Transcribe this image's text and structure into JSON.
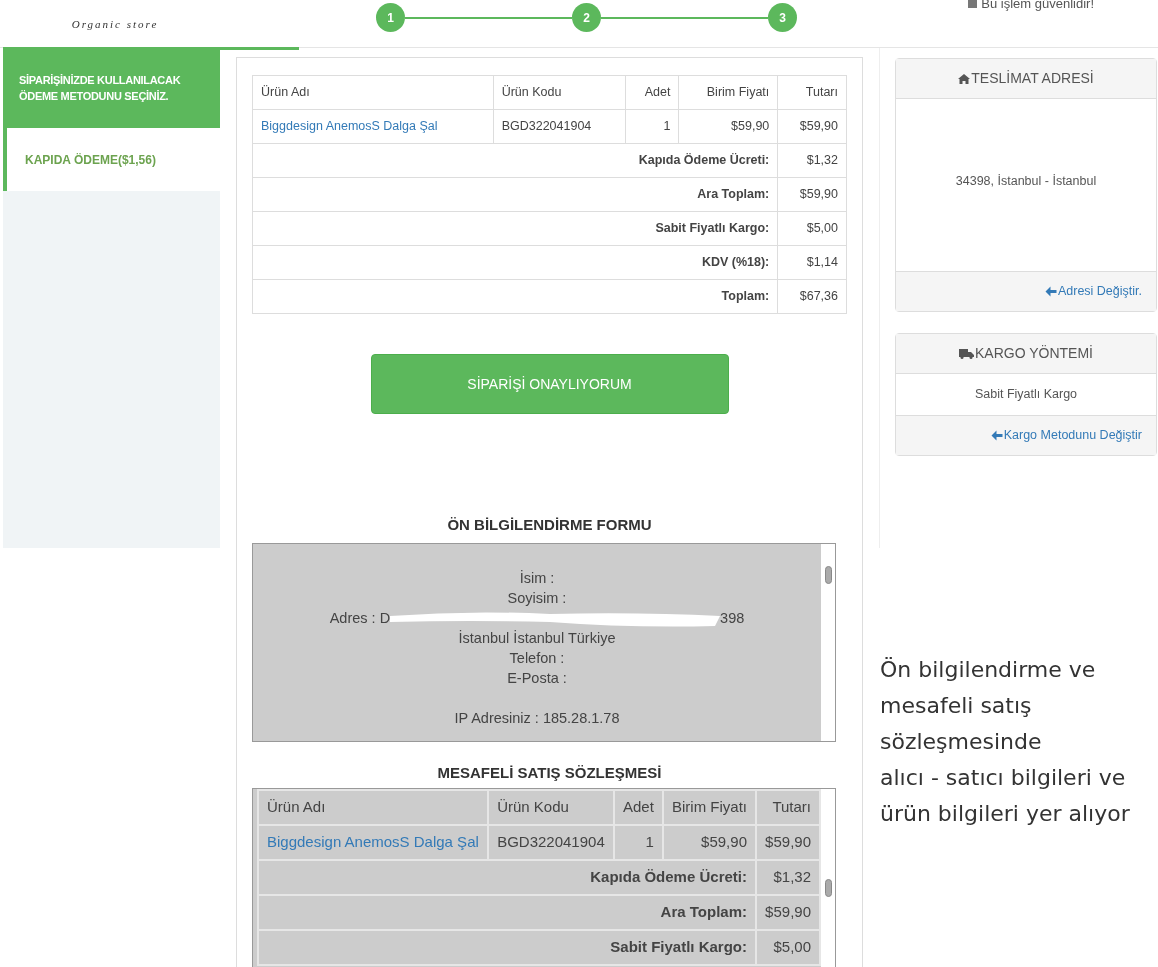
{
  "header": {
    "tagline": "Organic store",
    "steps": [
      {
        "label": "1"
      },
      {
        "label": "2"
      },
      {
        "label": "3"
      }
    ],
    "secure_note": "Bu işlem güvenlidir!"
  },
  "sidebar": {
    "title": "SİPARİŞİNİZDE KULLANILACAK ÖDEME METODUNU SEÇİNİZ.",
    "methods": [
      {
        "label": "KAPIDA ÖDEME($1,56)",
        "selected": true
      }
    ]
  },
  "order_table": {
    "columns": [
      "Ürün Adı",
      "Ürün Kodu",
      "Adet",
      "Birim Fiyatı",
      "Tutarı"
    ],
    "rows": [
      {
        "name": "Biggdesign AnemosS Dalga Şal",
        "code": "BGD322041904",
        "qty": "1",
        "unit_price": "$59,90",
        "total": "$59,90"
      }
    ],
    "summary": [
      {
        "label": "Kapıda Ödeme Ücreti:",
        "value": "$1,32"
      },
      {
        "label": "Ara Toplam:",
        "value": "$59,90"
      },
      {
        "label": "Sabit Fiyatlı Kargo:",
        "value": "$5,00"
      },
      {
        "label": "KDV (%18):",
        "value": "$1,14"
      },
      {
        "label": "Toplam:",
        "value": "$67,36"
      }
    ]
  },
  "confirm_button": "SİPARİŞİ ONAYLIYORUM",
  "info_form": {
    "title": "ÖN BİLGİLENDİRME FORMU",
    "lines": [
      {
        "kind": "text",
        "text": "İsim :"
      },
      {
        "kind": "text",
        "text": "Soyisim :"
      },
      {
        "kind": "redacted",
        "start": "Adres : D",
        "end": "398"
      },
      {
        "kind": "text",
        "text": "İstanbul İstanbul Türkiye"
      },
      {
        "kind": "text",
        "text": "Telefon :"
      },
      {
        "kind": "text",
        "text": "E-Posta :"
      },
      {
        "kind": "gap"
      },
      {
        "kind": "text",
        "text": "IP Adresiniz : 185.28.1.78"
      }
    ]
  },
  "contract": {
    "title": "MESAFELİ SATIŞ SÖZLEŞMESİ",
    "columns": [
      "Ürün Adı",
      "Ürün Kodu",
      "Adet",
      "Birim Fiyatı",
      "Tutarı"
    ],
    "rows": [
      {
        "name": "Biggdesign AnemosS Dalga Şal",
        "code": "BGD322041904",
        "qty": "1",
        "unit_price": "$59,90",
        "total": "$59,90"
      }
    ],
    "summary": [
      {
        "label": "Kapıda Ödeme Ücreti:",
        "value": "$1,32"
      },
      {
        "label": "Ara Toplam:",
        "value": "$59,90"
      },
      {
        "label": "Sabit Fiyatlı Kargo:",
        "value": "$5,00"
      }
    ]
  },
  "delivery": {
    "title": "TESLİMAT ADRESİ",
    "address": "34398, İstanbul - İstanbul",
    "change_link": "Adresi Değiştir."
  },
  "shipping": {
    "title": "KARGO YÖNTEMİ",
    "method": "Sabit Fiyatlı Kargo",
    "change_link": "Kargo Metodunu Değiştir"
  },
  "annotation": [
    "Ön bilgilendirme ve",
    "mesafeli satış",
    "sözleşmesinde",
    "alıcı - satıcı bilgileri ve",
    "ürün bilgileri yer alıyor"
  ]
}
